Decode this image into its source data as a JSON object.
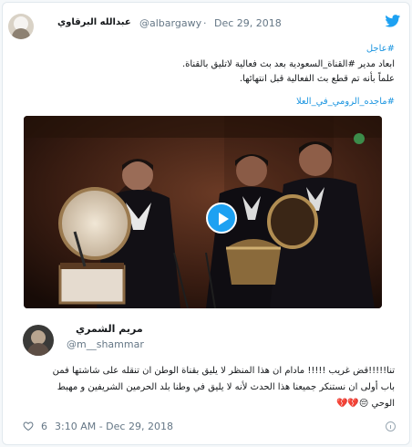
{
  "author": {
    "name": "عبدالله البرقاوي",
    "handle": "@albargawy",
    "separator": "·",
    "date": "Dec 29, 2018"
  },
  "tweet": {
    "line1": "#عاجل",
    "line2": "ابعاد مدير #القناة_السعودية بعد بث فعالية لاتليق بالقناة.",
    "line3": "علماً بأنه تم قطع بث الفعالية قبل انتهائها.",
    "hashtag": "#ماجده_الرومي_في_العلا"
  },
  "reply": {
    "name": "مريم الشمري",
    "handle": "@m__shammar",
    "line1": "تنا!!!!!قض غريب !!!!! مادام ان هذا المنظر لا يليق بقناة الوطن ان تنقله على شاشتها فمن",
    "line2": "باب أولى ان نستنكر جميعنا هذا الحدث لأنه لا يليق في وطنا بلد الحرمين الشريفين و مهبط",
    "line3": "الوحي 😔💔💔"
  },
  "footer": {
    "likes": "6",
    "timestamp": "3:10 AM - Dec 29, 2018"
  },
  "colors": {
    "link": "#1b95e0",
    "accent": "#1da1f2",
    "text": "#14171a",
    "muted": "#657786"
  }
}
